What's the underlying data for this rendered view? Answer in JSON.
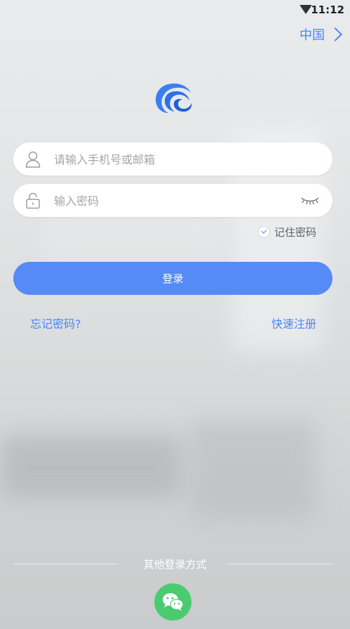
{
  "status_bar": {
    "time": "11:12",
    "wifi_icon": "wifi-icon"
  },
  "region": {
    "label": "中国",
    "icon": "chevron-right-icon"
  },
  "login_form": {
    "account_placeholder": "请输入手机号或邮箱",
    "account_value": "",
    "password_placeholder": "输入密码",
    "password_value": "",
    "remember_label": "记住密码",
    "remember_checked": true,
    "login_label": "登录",
    "forgot_label": "忘记密码?",
    "register_label": "快速注册"
  },
  "other_login": {
    "label": "其他登录方式",
    "wechat_icon": "wechat-icon"
  },
  "colors": {
    "accent": "#568af6",
    "link": "#4a86f7",
    "wechat": "#4bcb6f"
  }
}
